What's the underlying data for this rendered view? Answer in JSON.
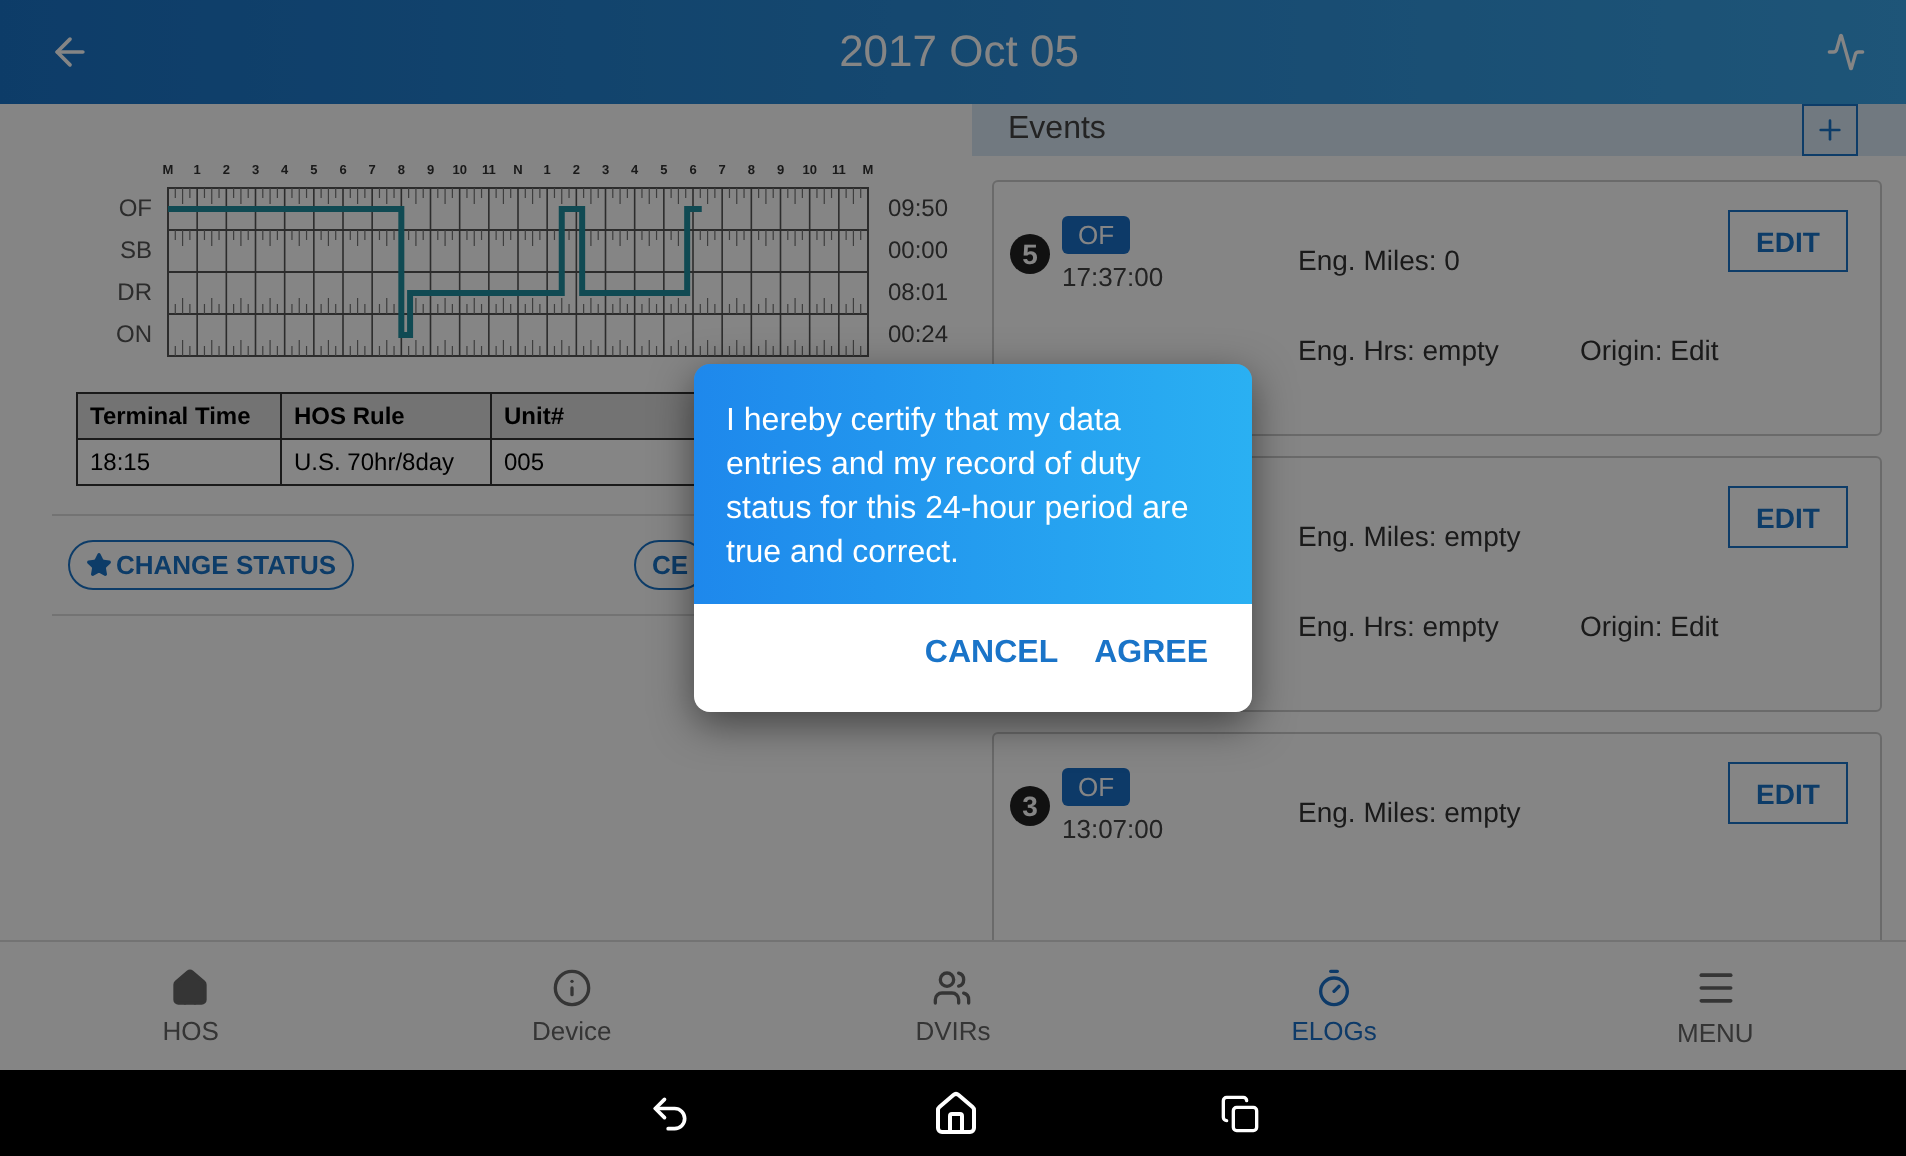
{
  "header": {
    "title": "2017 Oct 05"
  },
  "log_graph": {
    "hour_labels": [
      "M",
      "1",
      "2",
      "3",
      "4",
      "5",
      "6",
      "7",
      "8",
      "9",
      "10",
      "11",
      "N",
      "1",
      "2",
      "3",
      "4",
      "5",
      "6",
      "7",
      "8",
      "9",
      "10",
      "11",
      "M"
    ],
    "rows": [
      {
        "label": "OF",
        "total": "09:50"
      },
      {
        "label": "SB",
        "total": "00:00"
      },
      {
        "label": "DR",
        "total": "08:01"
      },
      {
        "label": "ON",
        "total": "00:24"
      }
    ]
  },
  "info_table": {
    "columns": [
      "Terminal Time",
      "HOS Rule",
      "Unit#"
    ],
    "rows": [
      [
        "18:15",
        "U.S. 70hr/8day",
        "005"
      ]
    ]
  },
  "actions": [
    {
      "label": "CHANGE STATUS",
      "starred": true
    },
    {
      "label": "CE",
      "starred": false
    }
  ],
  "events": {
    "title": "Events",
    "cards": [
      {
        "number": "5",
        "status": "OF",
        "time": "17:37:00",
        "miles": "Eng. Miles: 0",
        "hours": "Eng. Hrs: empty",
        "origin": "Origin: Edit",
        "edit": "EDIT"
      },
      {
        "miles": "Eng. Miles: empty",
        "hours": "Eng. Hrs: empty",
        "origin": "Origin: Edit",
        "edit": "EDIT"
      },
      {
        "number": "3",
        "status": "OF",
        "time": "13:07:00",
        "miles": "Eng. Miles: empty",
        "edit": "EDIT"
      }
    ]
  },
  "dialog": {
    "message": "I hereby certify that my data entries and my record of duty status for this 24-hour period are true and correct.",
    "buttons": [
      "CANCEL",
      "AGREE"
    ]
  },
  "nav": [
    {
      "label": "HOS",
      "selected": false
    },
    {
      "label": "Device",
      "selected": false
    },
    {
      "label": "DVIRs",
      "selected": false
    },
    {
      "label": "ELOGs",
      "selected": true
    },
    {
      "label": "MENU",
      "selected": false
    }
  ]
}
